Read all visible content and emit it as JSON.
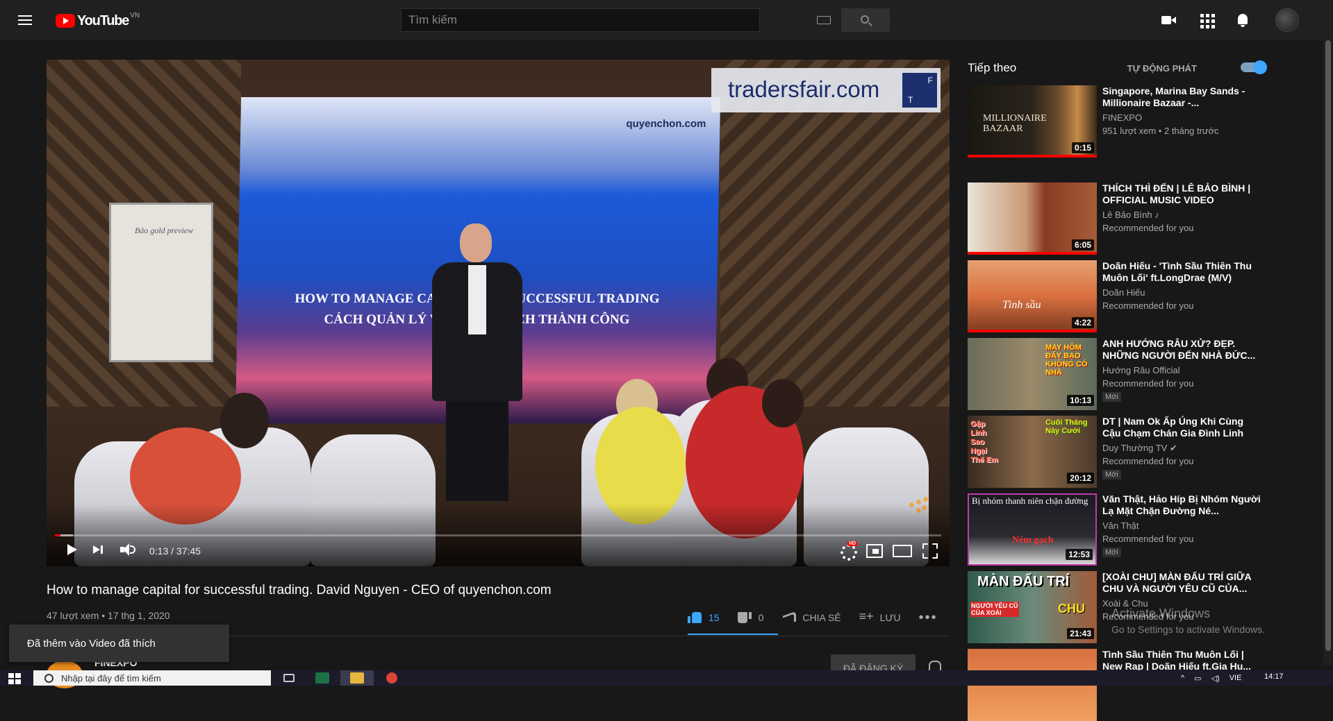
{
  "header": {
    "logo_text": "YouTube",
    "country_code": "VN",
    "search_placeholder": "Tìm kiếm"
  },
  "player": {
    "time_current": "0:13",
    "time_total": "37:45",
    "time_display": "0:13 / 37:45",
    "progress_fraction": 0.006,
    "buffer_fraction": 0.02,
    "overlay_banner": "tradersfair.com",
    "screen_logo": "quyenchon.com",
    "screen_line_1": "HOW TO MANAGE CAPITAL FOR SUCCESSFUL TRADING",
    "screen_line_2": "CÁCH QUẢN LÝ VỐN GIAO DỊCH THÀNH CÔNG",
    "hd_badge": "HD"
  },
  "video": {
    "title": "How to manage capital for successful trading. David Nguyen - CEO of quyenchon.com",
    "views": "47 lượt xem",
    "date": "17 thg 1, 2020",
    "likes": "15",
    "dislikes": "0",
    "share_label": "CHIA SẺ",
    "save_label": "LƯU",
    "more_label": "•••"
  },
  "channel": {
    "name": "FINEXPO",
    "subscribe_label": "ĐÃ ĐĂNG KÝ"
  },
  "toast": {
    "message": "Đã thêm vào Video đã thích"
  },
  "sidebar": {
    "up_next_label": "Tiếp theo",
    "autoplay_label": "TỰ ĐỘNG PHÁT",
    "autoplay_on": true,
    "items": [
      {
        "title": "Singapore, Marina Bay Sands - Millionaire Bazaar -...",
        "channel": "FINEXPO",
        "sub": "951 lượt xem • 2 tháng trước",
        "duration": "0:15",
        "watched": 1.0,
        "badge": ""
      },
      {
        "title": "THÍCH THÌ ĐẾN | LÊ BẢO BÌNH | OFFICIAL MUSIC VIDEO",
        "channel": "Lê Bảo Bình ♪",
        "sub": "Recommended for you",
        "duration": "6:05",
        "watched": 1.0,
        "badge": ""
      },
      {
        "title": "Doãn Hiếu - 'Tình Sầu Thiên Thu Muôn Lối' ft.LongDrae (M/V)",
        "channel": "Doãn Hiếu",
        "sub": "Recommended for you",
        "duration": "4:22",
        "watched": 1.0,
        "badge": ""
      },
      {
        "title": "ANH HƯỚNG RÂU XỬ? ĐẸP. NHỮNG NGƯỜI ĐẾN NHÀ ĐỨC...",
        "channel": "Hướng Râu Official",
        "sub": "Recommended for you",
        "duration": "10:13",
        "watched": 0,
        "badge": "Mới"
      },
      {
        "title": "DT | Nam Ok Ấp Úng Khi Cùng Cậu Chạm Chán Gia Đình Linh",
        "channel": "Duy Thường TV ✔",
        "sub": "Recommended for you",
        "duration": "20:12",
        "watched": 0,
        "badge": "Mới"
      },
      {
        "title": "Văn Thật, Hảo Híp Bị Nhóm Người Lạ Mặt Chặn Đường Né...",
        "channel": "Văn Thật",
        "sub": "Recommended for you",
        "duration": "12:53",
        "watched": 0,
        "badge": "Mới"
      },
      {
        "title": "[XOÀI CHU] MÀN ĐẤU TRÍ GIỮA CHU VÀ NGƯỜI YÊU CŨ CỦA...",
        "channel": "Xoài & Chu",
        "sub": "Recommended for you",
        "duration": "21:43",
        "watched": 0,
        "badge": ""
      },
      {
        "title": "Tình Sầu Thiên Thu Muôn Lối | New Rap | Doãn Hiếu ft.Gia Hu...",
        "channel": "",
        "sub": "",
        "duration": "",
        "watched": 0,
        "badge": ""
      }
    ],
    "thumb_texts": {
      "t1_a": "MILLIONAIRE",
      "t1_b": "BAZAAR",
      "t3": "Tình sầu",
      "t4": "MAY HÔM ĐẤY BẠO KHÔNG CÓ NHÀ",
      "t5_a": "Gặp Linh Sao Ngại Thế Em",
      "t5_b": "Cuối Tháng Này Cưới",
      "t6_a": "Bị nhóm thanh niên chặn đường",
      "t6_b": "Ném gạch",
      "t7_a": "MÀN ĐẤU TRÍ",
      "t7_b": "CHU",
      "t7_c": "NGƯỜI YÊU CŨ CỦA XOÀI"
    }
  },
  "watermark": {
    "line1": "Activate Windows",
    "line2": "Go to Settings to activate Windows."
  },
  "taskbar": {
    "search_placeholder": "Nhập tại đây để tìm kiếm",
    "lang": "VIE",
    "time": "14:17"
  },
  "colors": {
    "accent_blue": "#3ea6ff",
    "youtube_red": "#ff0000",
    "background": "#181818"
  }
}
